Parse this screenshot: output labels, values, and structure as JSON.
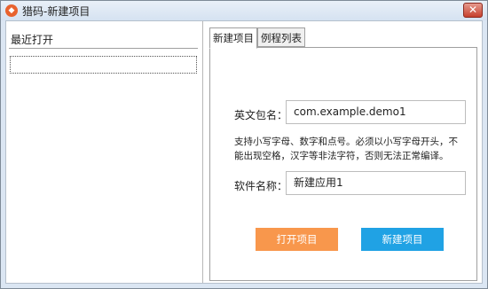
{
  "window": {
    "title": "猎码-新建项目",
    "close_glyph": "✕",
    "icon": "flame-logo-icon",
    "icon_glyph": "◆"
  },
  "left_panel": {
    "title": "最近打开"
  },
  "tabs": [
    {
      "label": "新建项目",
      "active": true
    },
    {
      "label": "例程列表",
      "active": false
    }
  ],
  "form": {
    "package_label": "英文包名：",
    "package_value": "com.example.demo1",
    "package_hint": "支持小写字母、数字和点号。必须以小写字母开头，不能出现空格，汉字等非法字符，否则无法正常编译。",
    "app_name_label": "软件名称：",
    "app_name_value": "新建应用1"
  },
  "buttons": {
    "open": "打开项目",
    "create": "新建项目"
  },
  "colors": {
    "open_button": "#f8974c",
    "create_button": "#20a2e4"
  }
}
